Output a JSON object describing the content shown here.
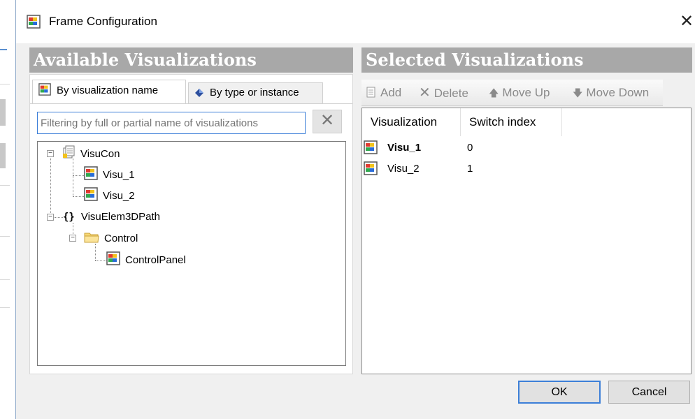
{
  "dialog": {
    "title": "Frame Configuration",
    "close_icon": "close-icon"
  },
  "available": {
    "header": "Available Visualizations",
    "tabs": [
      {
        "label": "By visualization name",
        "icon": "visualization-icon",
        "active": true
      },
      {
        "label": "By type or instance",
        "icon": "type-instance-icon",
        "active": false
      }
    ],
    "filter": {
      "value": "",
      "placeholder": "Filtering by full or partial name of visualizations",
      "clear_icon": "clear-icon"
    },
    "tree": [
      {
        "label": "VisuCon",
        "icon": "document-icon",
        "expanded": true
      },
      {
        "label": "Visu_1",
        "icon": "visualization-icon"
      },
      {
        "label": "Visu_2",
        "icon": "visualization-icon"
      },
      {
        "label": "VisuElem3DPath",
        "icon": "braces-icon",
        "expanded": true
      },
      {
        "label": "Control",
        "icon": "folder-icon",
        "expanded": true
      },
      {
        "label": "ControlPanel",
        "icon": "visualization-icon"
      }
    ]
  },
  "selected": {
    "header": "Selected Visualizations",
    "toolbar": {
      "add": "Add",
      "delete": "Delete",
      "move_up": "Move Up",
      "move_down": "Move Down"
    },
    "columns": [
      "Visualization",
      "Switch index"
    ],
    "rows": [
      {
        "name": "Visu_1",
        "index": "0",
        "bold": true
      },
      {
        "name": "Visu_2",
        "index": "1",
        "bold": false
      }
    ]
  },
  "buttons": {
    "ok": "OK",
    "cancel": "Cancel"
  },
  "colors": {
    "header_bg": "#a8a8a8",
    "focus_blue": "#3c7fd8",
    "dialog_bg": "#f0f0f0"
  }
}
